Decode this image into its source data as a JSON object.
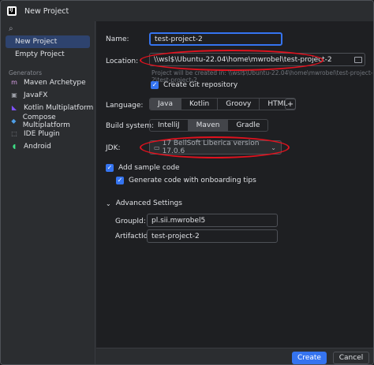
{
  "window": {
    "title": "New Project",
    "logo_letters": "IJ"
  },
  "sidebar": {
    "items": [
      {
        "label": "New Project"
      },
      {
        "label": "Empty Project"
      }
    ],
    "generators_heading": "Generators",
    "generators": [
      {
        "label": "Maven Archetype",
        "icon": "maven-m-icon",
        "glyph": "m",
        "color": "#d9a0e8"
      },
      {
        "label": "JavaFX",
        "icon": "javafx-icon",
        "glyph": "▣",
        "color": "#9da0a8"
      },
      {
        "label": "Kotlin Multiplatform",
        "icon": "kotlin-icon",
        "glyph": "◣",
        "color": "#7f52ff"
      },
      {
        "label": "Compose Multiplatform",
        "icon": "compose-icon",
        "glyph": "◆",
        "color": "#4f9fe8"
      },
      {
        "label": "IDE Plugin",
        "icon": "plugin-icon",
        "glyph": "⬚",
        "color": "#9da0a8"
      },
      {
        "label": "Android",
        "icon": "android-icon",
        "glyph": "◖",
        "color": "#3ddc84"
      }
    ]
  },
  "form": {
    "name_label": "Name:",
    "name_value": "test-project-2",
    "location_label": "Location:",
    "location_value": "\\\\wsl$\\Ubuntu-22.04\\home\\mwrobel\\test-project-2",
    "location_hint": "Project will be created in: \\\\wsl$\\Ubuntu-22.04\\home\\mwrobel\\test-project-2\\test-project-2",
    "git_label": "Create Git repository",
    "language_label": "Language:",
    "languages": [
      "Java",
      "Kotlin",
      "Groovy",
      "HTML"
    ],
    "selected_language": "Java",
    "build_label": "Build system:",
    "build_systems": [
      "IntelliJ",
      "Maven",
      "Gradle"
    ],
    "selected_build": "Maven",
    "jdk_label": "JDK:",
    "jdk_value": "17  BellSoft Liberica version 17.0.6",
    "sample_code_label": "Add sample code",
    "onboarding_label": "Generate code with onboarding tips",
    "advanced_label": "Advanced Settings",
    "groupid_label": "GroupId:",
    "groupid_value": "pl.sii.mwrobel5",
    "artifactid_label": "ArtifactId:",
    "artifactid_value": "test-project-2"
  },
  "buttons": {
    "create": "Create",
    "cancel": "Cancel"
  },
  "colors": {
    "accent": "#3574f0",
    "annotation_red": "#e0121e"
  }
}
